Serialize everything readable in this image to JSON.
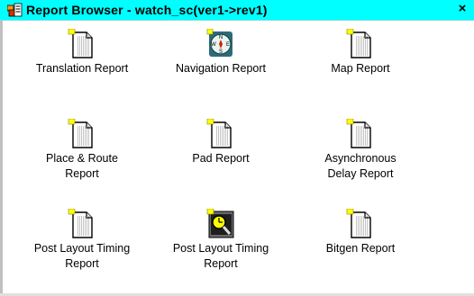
{
  "window": {
    "title": "Report Browser - watch_sc(ver1->rev1)",
    "close_glyph": "×"
  },
  "reports": [
    {
      "label": "Translation Report",
      "icon": "document-icon"
    },
    {
      "label": "Navigation Report",
      "icon": "compass-icon"
    },
    {
      "label": "Map Report",
      "icon": "document-icon"
    },
    {
      "label": "Place & Route\nReport",
      "icon": "document-icon"
    },
    {
      "label": "Pad Report",
      "icon": "document-icon"
    },
    {
      "label": "Asynchronous\nDelay Report",
      "icon": "document-icon"
    },
    {
      "label": "Post Layout Timing\nReport",
      "icon": "document-icon"
    },
    {
      "label": "Post Layout Timing\nReport",
      "icon": "timing-analyzer-icon"
    },
    {
      "label": "Bitgen Report",
      "icon": "document-icon"
    }
  ],
  "colors": {
    "titlebar": "#00ffff",
    "marker": "#ffff00"
  }
}
